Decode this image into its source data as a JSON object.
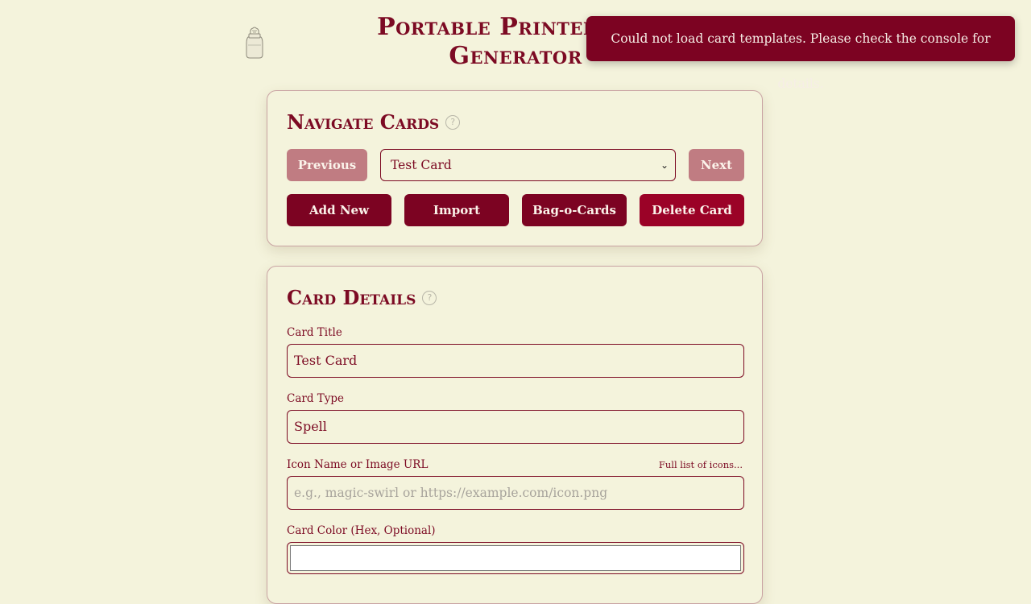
{
  "header": {
    "title_line1": "Portable Printer TTI",
    "title_line2": "Generator",
    "logo_icon": "jar-icon"
  },
  "toast": {
    "message": "Could not load card templates. Please check the console for details."
  },
  "navigate": {
    "heading": "Navigate Cards",
    "help_glyph": "?",
    "previous_label": "Previous",
    "selected_card": "Test Card",
    "next_label": "Next",
    "add_new_label": "Add New",
    "import_label": "Import",
    "bag_label": "Bag-o-Cards",
    "delete_label": "Delete Card"
  },
  "details": {
    "heading": "Card Details",
    "help_glyph": "?",
    "title_label": "Card Title",
    "title_value": "Test Card",
    "type_label": "Card Type",
    "type_value": "Spell",
    "icon_label": "Icon Name or Image URL",
    "icon_link": "Full list of icons...",
    "icon_placeholder": "e.g., magic-swirl or https://example.com/icon.png",
    "color_label": "Card Color (Hex, Optional)",
    "color_value": ""
  },
  "colors": {
    "accent": "#7c0a23",
    "background": "#f4f3dc",
    "toast_bg": "#7c0322",
    "button_muted": "#c07c82",
    "button_danger": "#9b0227"
  }
}
